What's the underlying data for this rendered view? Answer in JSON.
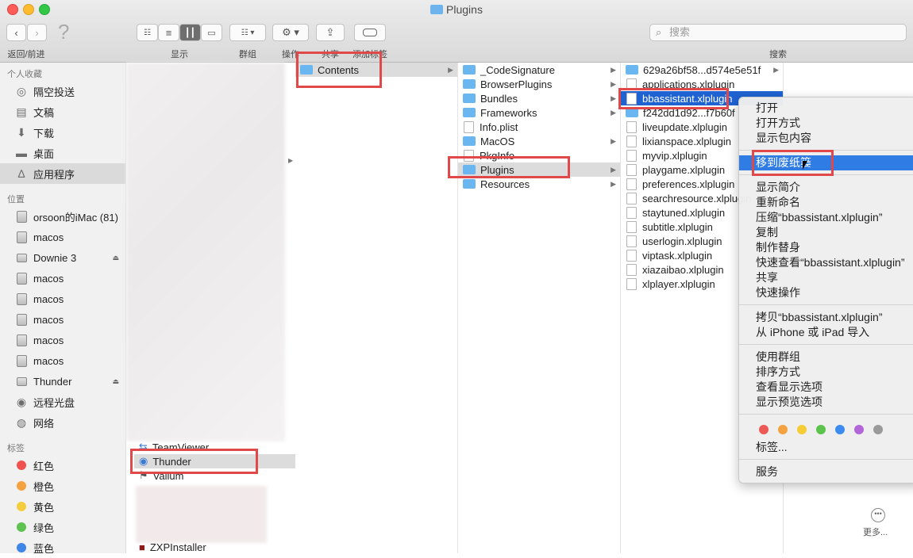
{
  "window": {
    "title": "Plugins"
  },
  "toolbar": {
    "nav_label": "返回/前进",
    "view_label": "显示",
    "group_label": "群组",
    "action_label": "操作",
    "share_label": "共享",
    "tags_label": "添加标签",
    "search_label": "搜索",
    "search_placeholder": "搜索"
  },
  "sidebar": {
    "favorites_header": "个人收藏",
    "favorites": [
      {
        "label": "隔空投送",
        "icon": "airdrop-icon"
      },
      {
        "label": "文稿",
        "icon": "documents-icon"
      },
      {
        "label": "下载",
        "icon": "downloads-icon"
      },
      {
        "label": "桌面",
        "icon": "desktop-icon"
      },
      {
        "label": "应用程序",
        "icon": "applications-icon"
      }
    ],
    "locations_header": "位置",
    "locations": [
      {
        "label": "orsoon的iMac (81)",
        "icon": "imac-icon"
      },
      {
        "label": "macos",
        "icon": "disk-icon"
      },
      {
        "label": "Downie 3",
        "icon": "drive-icon"
      },
      {
        "label": "macos",
        "icon": "disk-icon"
      },
      {
        "label": "macos",
        "icon": "disk-icon"
      },
      {
        "label": "macos",
        "icon": "disk-icon"
      },
      {
        "label": "macos",
        "icon": "disk-icon"
      },
      {
        "label": "macos",
        "icon": "disk-icon"
      },
      {
        "label": "Thunder",
        "icon": "drive-icon"
      },
      {
        "label": "远程光盘",
        "icon": "remote-disc-icon"
      },
      {
        "label": "网络",
        "icon": "network-icon"
      }
    ],
    "tags_header": "标签",
    "tags": [
      {
        "label": "红色",
        "color": "#f0534f"
      },
      {
        "label": "橙色",
        "color": "#f5a142"
      },
      {
        "label": "黄色",
        "color": "#f5cd3c"
      },
      {
        "label": "绿色",
        "color": "#5dc24f"
      },
      {
        "label": "蓝色",
        "color": "#3e86e8"
      }
    ]
  },
  "column1": {
    "items": [
      "TeamViewer",
      "Thunder",
      "Valium",
      "ZXPInstaller"
    ]
  },
  "column2": {
    "items": [
      "Contents"
    ]
  },
  "column3": {
    "items": [
      "_CodeSignature",
      "BrowserPlugins",
      "Bundles",
      "Frameworks",
      "Info.plist",
      "MacOS",
      "PkgInfo",
      "Plugins",
      "Resources"
    ]
  },
  "column4": {
    "items": [
      "629a26bf58...d574e5e51f",
      "applications.xlplugin",
      "bbassistant.xlplugin",
      "f242dd1d92...f7b60f",
      "liveupdate.xlplugin",
      "lixianspace.xlplugin",
      "myvip.xlplugin",
      "playgame.xlplugin",
      "preferences.xlplugin",
      "searchresource.xlplugin",
      "staytuned.xlplugin",
      "subtitle.xlplugin",
      "userlogin.xlplugin",
      "viptask.xlplugin",
      "xiazaibao.xlplugin",
      "xlplayer.xlplugin"
    ]
  },
  "context_menu": {
    "items": [
      "打开",
      "打开方式",
      "显示包内容",
      "移到废纸篓",
      "显示简介",
      "重新命名",
      "压缩“bbassistant.xlplugin”",
      "复制",
      "制作替身",
      "快速查看“bbassistant.xlplugin”",
      "共享",
      "快速操作",
      "拷贝“bbassistant.xlplugin”",
      "从 iPhone 或 iPad 导入",
      "使用群组",
      "排序方式",
      "查看显示选项",
      "显示预览选项",
      "标签...",
      "服务"
    ],
    "tag_colors": [
      "#ed5a55",
      "#f4a23f",
      "#f6cc36",
      "#5cc44c",
      "#3c8cf0",
      "#b266d8",
      "#9a9a9a"
    ]
  },
  "preview": {
    "more_label": "更多..."
  }
}
